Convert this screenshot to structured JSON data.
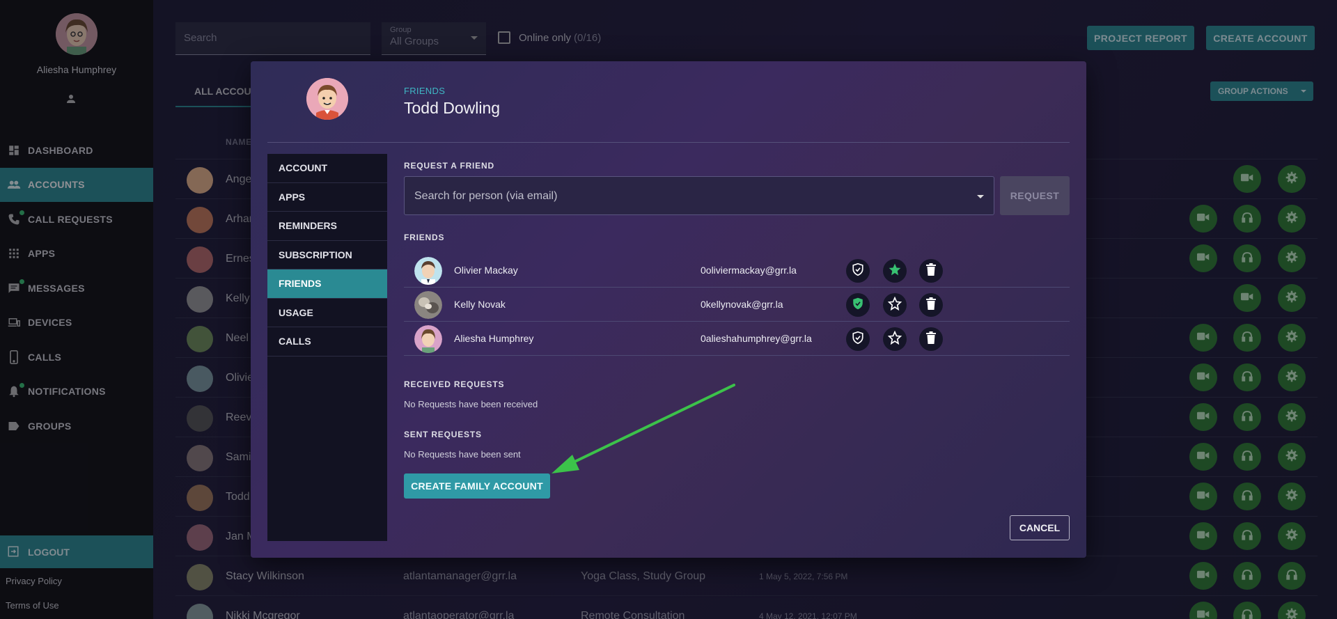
{
  "sidebar": {
    "user_name": "Aliesha Humphrey",
    "items": [
      {
        "label": "DASHBOARD",
        "icon": "dashboard-icon"
      },
      {
        "label": "ACCOUNTS",
        "icon": "people-icon"
      },
      {
        "label": "CALL REQUESTS",
        "icon": "phone-icon"
      },
      {
        "label": "APPS",
        "icon": "apps-grid-icon"
      },
      {
        "label": "MESSAGES",
        "icon": "message-icon"
      },
      {
        "label": "DEVICES",
        "icon": "devices-icon"
      },
      {
        "label": "CALLS",
        "icon": "mobile-phone-icon"
      },
      {
        "label": "NOTIFICATIONS",
        "icon": "bell-icon"
      },
      {
        "label": "GROUPS",
        "icon": "label-tag-icon"
      }
    ],
    "logout_label": "LOGOUT",
    "privacy_label": "Privacy Policy",
    "terms_label": "Terms of Use"
  },
  "toolbar": {
    "search_placeholder": "Search",
    "group_label": "Group",
    "group_value": "All Groups",
    "online_label": "Online only",
    "online_count": "(0/16)",
    "project_report": "PROJECT REPORT",
    "create_account": "CREATE ACCOUNT",
    "group_actions": "GROUP ACTIONS"
  },
  "table": {
    "tab_all": "ALL ACCOUNTS",
    "col_name": "NAME",
    "rows": [
      {
        "name": "Ange",
        "email": "",
        "groups": "",
        "meta": ""
      },
      {
        "name": "Arhan",
        "email": "",
        "groups": "",
        "meta": ""
      },
      {
        "name": "Ernes",
        "email": "",
        "groups": "",
        "meta": ""
      },
      {
        "name": "Kelly",
        "email": "",
        "groups": "",
        "meta": ""
      },
      {
        "name": "Neel",
        "email": "",
        "groups": "",
        "meta": ""
      },
      {
        "name": "Olivie",
        "email": "",
        "groups": "",
        "meta": ""
      },
      {
        "name": "Reev",
        "email": "",
        "groups": "",
        "meta": ""
      },
      {
        "name": "Sami",
        "email": "",
        "groups": "",
        "meta": ""
      },
      {
        "name": "Todd",
        "email": "",
        "groups": "",
        "meta": ""
      },
      {
        "name": "Jan M",
        "email": "",
        "groups": "",
        "meta": ""
      },
      {
        "name": "Stacy Wilkinson",
        "email": "atlantamanager@grr.la",
        "groups": "Yoga Class, Study Group",
        "meta": "1   May 5, 2022, 7:56 PM"
      },
      {
        "name": "Nikki Mcgregor",
        "email": "atlantaoperator@grr.la",
        "groups": "Remote Consultation",
        "meta": "4   May 12, 2021, 12:07 PM"
      }
    ]
  },
  "modal": {
    "section_label": "FRIENDS",
    "person_name": "Todd Dowling",
    "menu": [
      "ACCOUNT",
      "APPS",
      "REMINDERS",
      "SUBSCRIPTION",
      "FRIENDS",
      "USAGE",
      "CALLS"
    ],
    "request_heading": "REQUEST A FRIEND",
    "request_placeholder": "Search for person (via email)",
    "request_button": "REQUEST",
    "friends_heading": "FRIENDS",
    "friends": [
      {
        "name": "Olivier Mackay",
        "email": "0oliviermackay@grr.la",
        "shield_active": false,
        "starred": true
      },
      {
        "name": "Kelly Novak",
        "email": "0kellynovak@grr.la",
        "shield_active": true,
        "starred": false
      },
      {
        "name": "Aliesha Humphrey",
        "email": "0alieshahumphrey@grr.la",
        "shield_active": false,
        "starred": false
      }
    ],
    "received_heading": "RECEIVED REQUESTS",
    "received_note": "No Requests have been received",
    "sent_heading": "SENT REQUESTS",
    "sent_note": "No Requests have been sent",
    "create_family": "CREATE FAMILY ACCOUNT",
    "cancel": "CANCEL"
  },
  "colors": {
    "accent": "#2a8a93",
    "success_green": "#2e7d32",
    "modal_label": "#3fb6c4"
  }
}
